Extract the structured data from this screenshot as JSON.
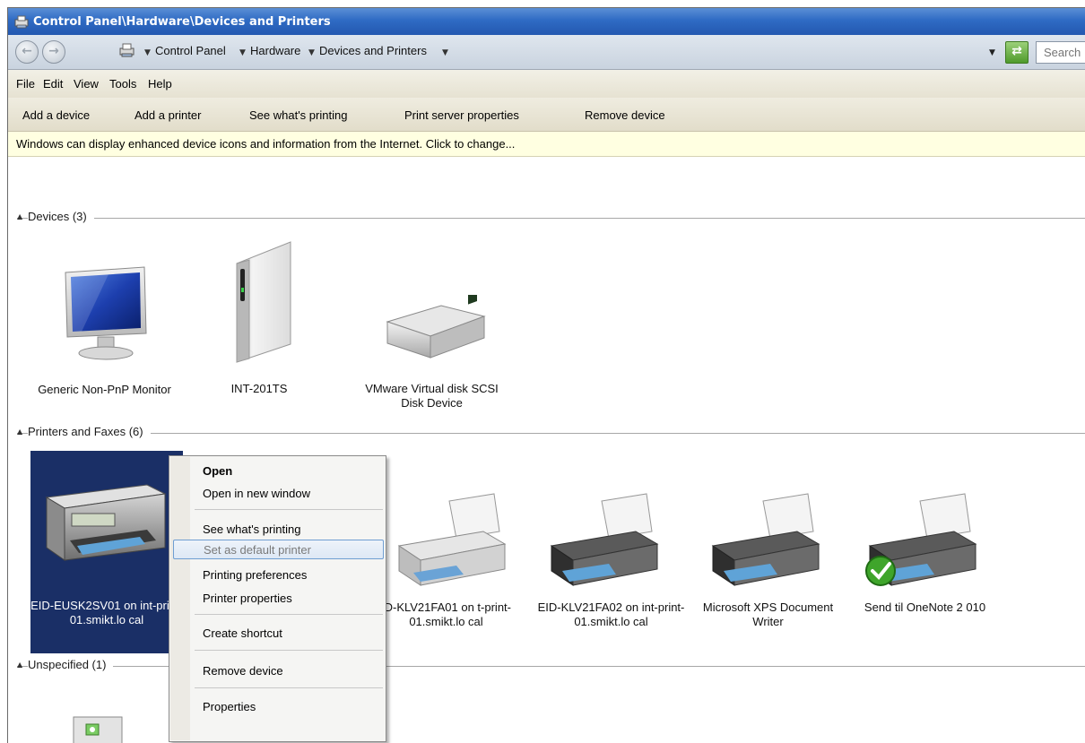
{
  "window": {
    "title": "Control Panel\\Hardware\\Devices and Printers"
  },
  "address": {
    "crumbs": [
      "Control Panel",
      "Hardware",
      "Devices and Printers"
    ],
    "search_placeholder": "Search"
  },
  "menu": [
    "File",
    "Edit",
    "View",
    "Tools",
    "Help"
  ],
  "commands": [
    "Add a device",
    "Add a printer",
    "See what's printing",
    "Print server properties",
    "Remove device"
  ],
  "infobar": "Windows can display enhanced device icons and information from the Internet. Click to change...",
  "groups": {
    "devices": "Devices (3)",
    "printers": "Printers and Faxes (6)",
    "unspecified": "Unspecified (1)"
  },
  "devices": [
    {
      "label": "Generic Non-PnP Monitor",
      "icon": "monitor-icon"
    },
    {
      "label": "INT-201TS",
      "icon": "computer-tower-icon"
    },
    {
      "label": "VMware Virtual disk SCSI Disk Device",
      "icon": "hard-disk-icon"
    }
  ],
  "printers": [
    {
      "label": "EID-EUSK2SV01 on int-print-01.smikt.lo cal",
      "icon": "multifunction-printer-icon",
      "selected": true
    },
    {
      "label": "ID-KLV21FA01 on t-print-01.smikt.lo cal",
      "icon": "printer-icon"
    },
    {
      "label": "EID-KLV21FA02 on int-print-01.smikt.lo cal",
      "icon": "printer-icon"
    },
    {
      "label": "Microsoft XPS Document Writer",
      "icon": "printer-icon"
    },
    {
      "label": "Send til OneNote 2 010",
      "icon": "printer-default-check-icon"
    }
  ],
  "context_menu": {
    "items": [
      "Open",
      "Open in new window",
      "See what's printing",
      "Set as default printer",
      "Printing preferences",
      "Printer properties",
      "Create shortcut",
      "Remove device",
      "Properties"
    ],
    "highlighted": "Set as default printer"
  },
  "colors": {
    "title_bar": "#2f6bc4",
    "selection": "#1a2f66",
    "infobar": "#ffffe1"
  }
}
